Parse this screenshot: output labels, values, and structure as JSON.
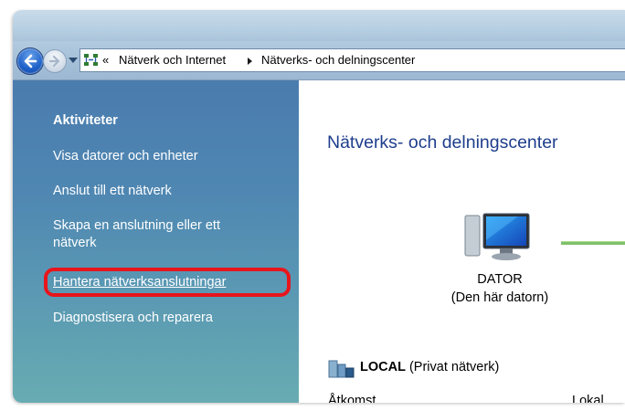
{
  "address_bar": {
    "overflow_glyph": "«",
    "breadcrumbs": [
      "Nätverk och Internet",
      "Nätverks- och delningscenter"
    ]
  },
  "sidebar": {
    "heading": "Aktiviteter",
    "items": [
      {
        "label": "Visa datorer och enheter"
      },
      {
        "label": "Anslut till ett nätverk"
      },
      {
        "label_line1": "Skapa en anslutning eller ett",
        "label_line2": "nätverk"
      },
      {
        "label": "Hantera nätverksanslutningar",
        "highlighted": true
      },
      {
        "label": "Diagnostisera och reparera"
      }
    ]
  },
  "main": {
    "title": "Nätverks- och delningscenter",
    "computer": {
      "name": "DATOR",
      "subtitle": "(Den här datorn)"
    },
    "network": {
      "name": "LOCAL",
      "type": "(Privat nätverk)"
    },
    "details": {
      "access_label": "Åtkomst",
      "access_value": "Lokal"
    }
  },
  "colors": {
    "sidebar_top": "#4a7cae",
    "sidebar_bottom": "#68acb2",
    "title_blue": "#1e3e8c",
    "highlight_red": "#e8151c",
    "connection_green": "#7fc06a"
  },
  "icons": [
    "back-arrow-icon",
    "forward-arrow-icon",
    "network-icon",
    "computer-icon",
    "network-location-icon"
  ]
}
